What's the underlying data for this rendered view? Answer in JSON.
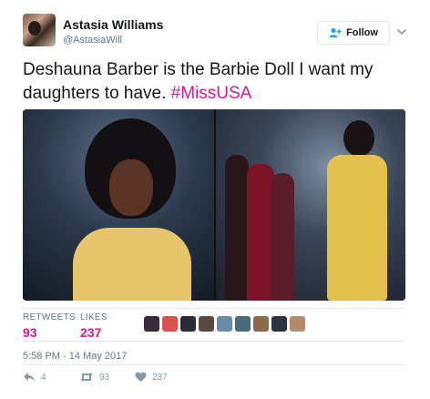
{
  "author": {
    "display_name": "Astasia Williams",
    "handle": "@AstasiaWill"
  },
  "follow_button": {
    "label": "Follow"
  },
  "tweet": {
    "text": "Deshauna Barber is the Barbie Doll I want my daughters to have.",
    "hashtag": "#MissUSA"
  },
  "stats": {
    "retweets_label": "RETWEETS",
    "retweets_value": "93",
    "likes_label": "LIKES",
    "likes_value": "237"
  },
  "liker_colors": [
    "#3b2a3a",
    "#d9524f",
    "#2b2b35",
    "#5a4a44",
    "#6a8aa8",
    "#4a6a7a",
    "#8a6a4a",
    "#2c3440",
    "#b58a6a"
  ],
  "timestamp": "5:58 PM - 14 May 2017",
  "actions": {
    "reply_count": "4",
    "retweet_count": "93",
    "like_count": "237"
  },
  "colors": {
    "accent": "#e0168c",
    "muted": "#657786",
    "action_gray": "#8899a6",
    "border": "#e1e8ed"
  }
}
